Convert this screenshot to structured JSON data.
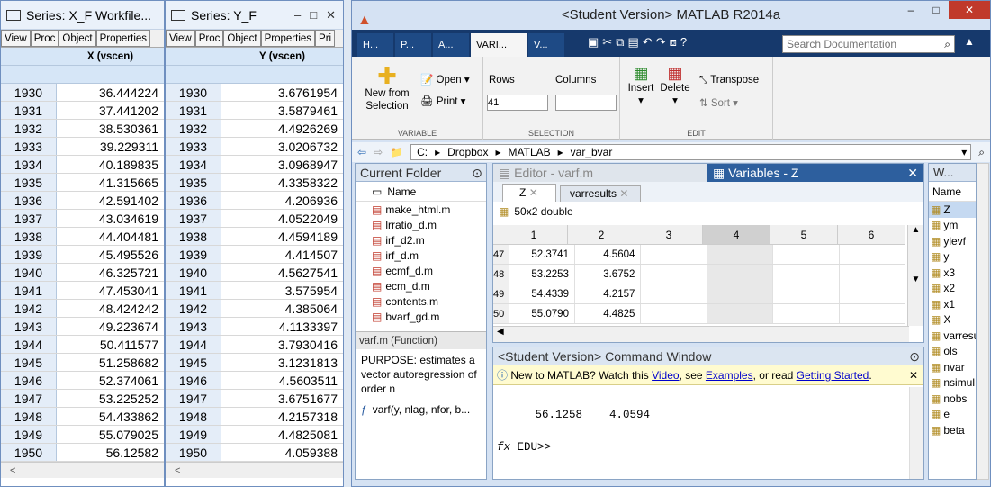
{
  "series_x": {
    "title": "Series: X_F   Workfile...",
    "toolbar": [
      "View",
      "Proc",
      "Object",
      "Properties"
    ],
    "column": "X (vscen)",
    "rows": [
      [
        "1930",
        "36.444224"
      ],
      [
        "1931",
        "37.441202"
      ],
      [
        "1932",
        "38.530361"
      ],
      [
        "1933",
        "39.229311"
      ],
      [
        "1934",
        "40.189835"
      ],
      [
        "1935",
        "41.315665"
      ],
      [
        "1936",
        "42.591402"
      ],
      [
        "1937",
        "43.034619"
      ],
      [
        "1938",
        "44.404481"
      ],
      [
        "1939",
        "45.495526"
      ],
      [
        "1940",
        "46.325721"
      ],
      [
        "1941",
        "47.453041"
      ],
      [
        "1942",
        "48.424242"
      ],
      [
        "1943",
        "49.223674"
      ],
      [
        "1944",
        "50.411577"
      ],
      [
        "1945",
        "51.258682"
      ],
      [
        "1946",
        "52.374061"
      ],
      [
        "1947",
        "53.225252"
      ],
      [
        "1948",
        "54.433862"
      ],
      [
        "1949",
        "55.079025"
      ],
      [
        "1950",
        "56.12582"
      ]
    ]
  },
  "series_y": {
    "title": "Series: Y_F",
    "toolbar": [
      "View",
      "Proc",
      "Object",
      "Properties",
      "Pri"
    ],
    "column": "Y (vscen)",
    "rows": [
      [
        "1930",
        "3.6761954"
      ],
      [
        "1931",
        "3.5879461"
      ],
      [
        "1932",
        "4.4926269"
      ],
      [
        "1933",
        "3.0206732"
      ],
      [
        "1934",
        "3.0968947"
      ],
      [
        "1935",
        "4.3358322"
      ],
      [
        "1936",
        "4.206936"
      ],
      [
        "1937",
        "4.0522049"
      ],
      [
        "1938",
        "4.4594189"
      ],
      [
        "1939",
        "4.414507"
      ],
      [
        "1940",
        "4.5627541"
      ],
      [
        "1941",
        "3.575954"
      ],
      [
        "1942",
        "4.385064"
      ],
      [
        "1943",
        "4.1133397"
      ],
      [
        "1944",
        "3.7930416"
      ],
      [
        "1945",
        "3.1231813"
      ],
      [
        "1946",
        "4.5603511"
      ],
      [
        "1947",
        "3.6751677"
      ],
      [
        "1948",
        "4.2157318"
      ],
      [
        "1949",
        "4.4825081"
      ],
      [
        "1950",
        "4.059388"
      ]
    ]
  },
  "matlab": {
    "title": "<Student Version> MATLAB R2014a",
    "tabs": [
      "H...",
      "P...",
      "A...",
      "VARI...",
      "V..."
    ],
    "search_placeholder": "Search Documentation",
    "ribbon": {
      "new_from_selection": "New from Selection",
      "open": "Open",
      "print": "Print",
      "variable_group": "VARIABLE",
      "rows_label": "Rows",
      "columns_label": "Columns",
      "rows_value": "41",
      "columns_value": "",
      "selection_group": "SELECTION",
      "insert": "Insert",
      "delete": "Delete",
      "transpose": "Transpose",
      "sort": "Sort",
      "edit_group": "EDIT"
    },
    "path": [
      "C:",
      "Dropbox",
      "MATLAB",
      "var_bvar"
    ],
    "current_folder": {
      "title": "Current Folder",
      "name_col": "Name",
      "files": [
        "make_html.m",
        "lrratio_d.m",
        "irf_d2.m",
        "irf_d.m",
        "ecmf_d.m",
        "ecm_d.m",
        "contents.m",
        "bvarf_gd.m"
      ],
      "detail_title": "varf.m (Function)",
      "purpose": "PURPOSE: estimates a vector autoregression of order n",
      "signature": "varf(y, nlag, nfor, b..."
    },
    "editor_title": "Editor - varf.m",
    "variables": {
      "title": "Variables - Z",
      "tabs": [
        "Z",
        "varresults"
      ],
      "info": "50x2 double",
      "col_headers": [
        "1",
        "2",
        "3",
        "4",
        "5",
        "6"
      ],
      "rows": [
        [
          "47",
          "52.3741",
          "4.5604"
        ],
        [
          "48",
          "53.2253",
          "3.6752"
        ],
        [
          "49",
          "54.4339",
          "4.2157"
        ],
        [
          "50",
          "55.0790",
          "4.4825"
        ]
      ]
    },
    "command": {
      "title": "<Student Version> Command Window",
      "banner_pre": "New to MATLAB? Watch this ",
      "video": "Video",
      "banner_mid": ", see ",
      "examples": "Examples",
      "banner_mid2": ", or read ",
      "getting_started": "Getting Started",
      "banner_end": ".",
      "output": "   56.1258    4.0594",
      "prompt": "EDU>>"
    },
    "workspace": {
      "title": "W...",
      "name_col": "Name",
      "vars": [
        "Z",
        "ym",
        "ylevf",
        "y",
        "x3",
        "x2",
        "x1",
        "X",
        "varresu",
        "ols",
        "nvar",
        "nsimul",
        "nobs",
        "e",
        "beta"
      ]
    }
  }
}
